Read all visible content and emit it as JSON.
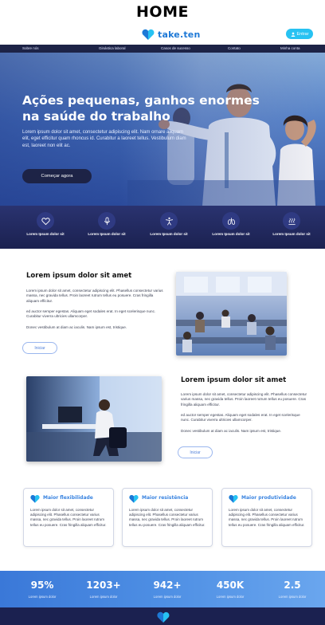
{
  "page_label": "HOME",
  "brand": {
    "name": "take.ten"
  },
  "topbar": {
    "enter_label": "Entrar"
  },
  "nav": [
    "Sobre nós",
    "Ginástica laboral",
    "Casos de sucesso",
    "Contato",
    "Minha conta"
  ],
  "hero": {
    "title": "Ações pequenas, ganhos enormes na saúde do trabalho",
    "text": "Lorem ipsum dolor sit amet, consectetur adipiscing elit. Nam ornare aliquam elit, eget efficitur quam rhoncus id. Curabitur a laoreet tellus. Vestibulum diam est, laoreet non elit ac.",
    "cta": "Começar agora"
  },
  "features": [
    {
      "label": "Lorem Ipsum dolor sit",
      "icon": "heart-outline-icon"
    },
    {
      "label": "Lorem Ipsum dolor sit",
      "icon": "microphone-icon"
    },
    {
      "label": "Lorem Ipsum dolor sit",
      "icon": "person-stretch-icon"
    },
    {
      "label": "Lorem Ipsum dolor sit",
      "icon": "lungs-icon"
    },
    {
      "label": "Lorem Ipsum dolor sit",
      "icon": "wellness-icon"
    }
  ],
  "section1": {
    "title": "Lorem ipsum dolor sit amet",
    "p1": "Lorem ipsum dolor sit amet, consectetur adipiscing elit. Phasellus consectetur varius massa, nec gravida tellus. Proin laoreet rutrum tellus eu posuere. Cras fringilla aliquam efficitur.",
    "p2": "ed auctor semper egestas. Aliquam eget sodales erat. In eget scelerisque nunc. Curabitur viverra ultricies ullamcorper.",
    "p3": "Donec vestibulum at diam ac iaculis. Nam ipsum est, tristique.",
    "button": "Iniciar"
  },
  "section2": {
    "title": "Lorem ipsum dolor sit amet",
    "p1": "Lorem ipsum dolor sit amet, consectetur adipiscing elit. Phasellus consectetur varius massa, nec gravida tellus. Proin laoreet rutrum tellus eu posuere. Cras fringilla aliquam efficitur.",
    "p2": "ed auctor semper egestas. Aliquam eget sodales erat. In eget scelerisque nunc. Curabitur viverra ultricies ullamcorper.",
    "p3": "Donec vestibulum at diam ac iaculis. Nam ipsum est, tristique.",
    "button": "Iniciar"
  },
  "cards": [
    {
      "title": "Maior flexibilidade",
      "text": "Lorem ipsum dolor sit amet, consectetur adipiscing elit. Phasellus consectetur varius massa, nec gravida tellus. Proin laoreet rutrum tellus eu posuere. Cras fringilla aliquam efficitur."
    },
    {
      "title": "Maior resistência",
      "text": "Lorem ipsum dolor sit amet, consectetur adipiscing elit. Phasellus consectetur varius massa, nec gravida tellus. Proin laoreet rutrum tellus eu posuere. Cras fringilla aliquam efficitur."
    },
    {
      "title": "Maior produtividade",
      "text": "Lorem ipsum dolor sit amet, consectetur adipiscing elit. Phasellus consectetur varius massa, nec gravida tellus. Proin laoreet rutrum tellus eu posuere. Cras fringilla aliquam efficitur."
    }
  ],
  "stats": [
    {
      "value": "95%",
      "label": "Lorem ipsum dolor"
    },
    {
      "value": "1203+",
      "label": "Lorem ipsum dolor"
    },
    {
      "value": "942+",
      "label": "Lorem ipsum dolor"
    },
    {
      "value": "450K",
      "label": "Lorem ipsum dolor"
    },
    {
      "value": "2.5",
      "label": "Lorem ipsum dolor"
    }
  ],
  "colors": {
    "brand_blue": "#1d78d6",
    "accent_cyan": "#27c2f2",
    "navy": "#1d2346",
    "card_title": "#3a84e0"
  }
}
